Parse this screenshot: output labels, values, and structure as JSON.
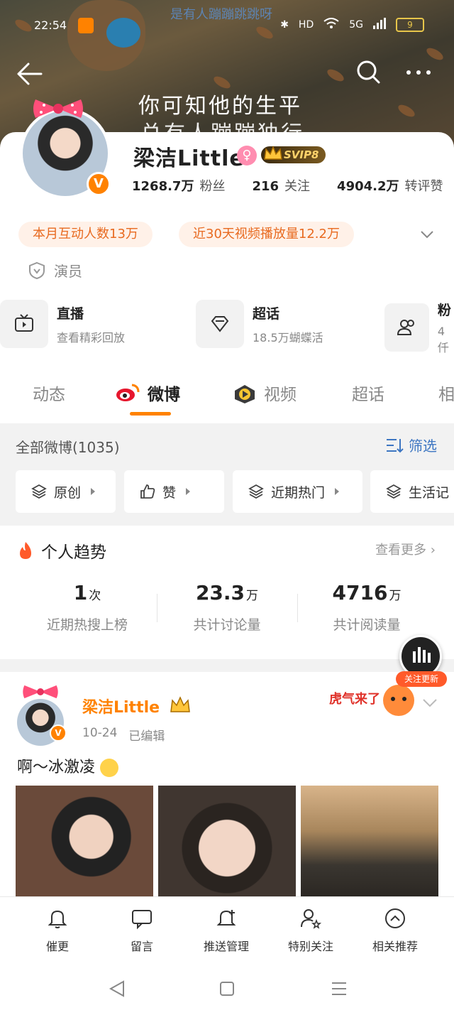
{
  "status_bar": {
    "time": "22:54",
    "network": "5G",
    "hd": "HD",
    "battery": "9"
  },
  "cover": {
    "watermark": "是有人蹦蹦跳跳呀",
    "line1": "你可知他的生平",
    "line2": "总有人蹦蹦独行"
  },
  "profile": {
    "name": "梁洁Little",
    "svip": "SVIP8",
    "stats": [
      {
        "value": "1268.7万",
        "label": "粉丝"
      },
      {
        "value": "216",
        "label": "关注"
      },
      {
        "value": "4904.2万",
        "label": "转评赞"
      }
    ],
    "pills": [
      "本月互动人数13万",
      "近30天视频播放量12.2万"
    ],
    "role": "演员",
    "cards": [
      {
        "title": "直播",
        "subtitle": "查看精彩回放"
      },
      {
        "title": "超话",
        "subtitle": "18.5万蝴蝶活"
      },
      {
        "title": "粉",
        "subtitle": "4仟"
      }
    ]
  },
  "tabs": [
    "动态",
    "微博",
    "视频",
    "超话",
    "相"
  ],
  "filter": {
    "all_weibo": "全部微博(1035)",
    "filter_label": "筛选",
    "chips": [
      "原创",
      "赞",
      "近期热门",
      "生活记"
    ]
  },
  "trend": {
    "title": "个人趋势",
    "more": "查看更多",
    "items": [
      {
        "value": "1",
        "unit": "次",
        "label": "近期热搜上榜"
      },
      {
        "value": "23.3",
        "unit": "万",
        "label": "共计讨论量"
      },
      {
        "value": "4716",
        "unit": "万",
        "label": "共计阅读量"
      }
    ]
  },
  "float_button": {
    "label": "关注更新"
  },
  "post": {
    "author": "梁洁Little",
    "date": "10-24",
    "edited": "已编辑",
    "text": "啊～冰激凌",
    "sticker": "虎气来了"
  },
  "bottom_bar": [
    "催更",
    "留言",
    "推送管理",
    "特别关注",
    "相关推荐"
  ],
  "colors": {
    "accent": "#ff8200",
    "link": "#3d76c2",
    "pill_text": "#e86a20"
  }
}
